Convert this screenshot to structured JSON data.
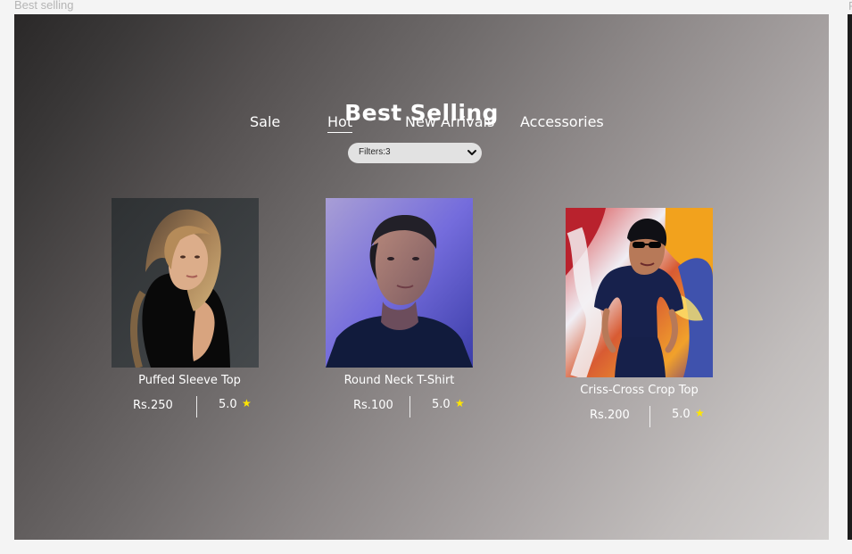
{
  "frame": {
    "label": "Best selling",
    "next_frame_label": "F"
  },
  "header": {
    "title": "Best Selling"
  },
  "tabs": [
    {
      "label": "Sale",
      "active": false
    },
    {
      "label": "Hot",
      "active": true
    },
    {
      "label": "New Arrivals",
      "active": false
    },
    {
      "label": "Accessories",
      "active": false
    }
  ],
  "filter": {
    "label": "Filters:3",
    "icon": "chevron-down-icon"
  },
  "products": [
    {
      "name": "Puffed Sleeve Top",
      "price": "Rs.250",
      "rating": "5.0",
      "star_icon": "star-icon"
    },
    {
      "name": "Round Neck T-Shirt",
      "price": "Rs.100",
      "rating": "5.0",
      "star_icon": "star-icon"
    },
    {
      "name": "Criss-Cross Crop Top",
      "price": "Rs.200",
      "rating": "5.0",
      "star_icon": "star-icon"
    }
  ],
  "colors": {
    "canvas_background": "#f4f4f4",
    "gradient_dark": "#2a2828",
    "gradient_light": "#d3d0cf",
    "text": "#ffffff",
    "star": "#ffe600",
    "filter_background": "#e2e2e2"
  }
}
